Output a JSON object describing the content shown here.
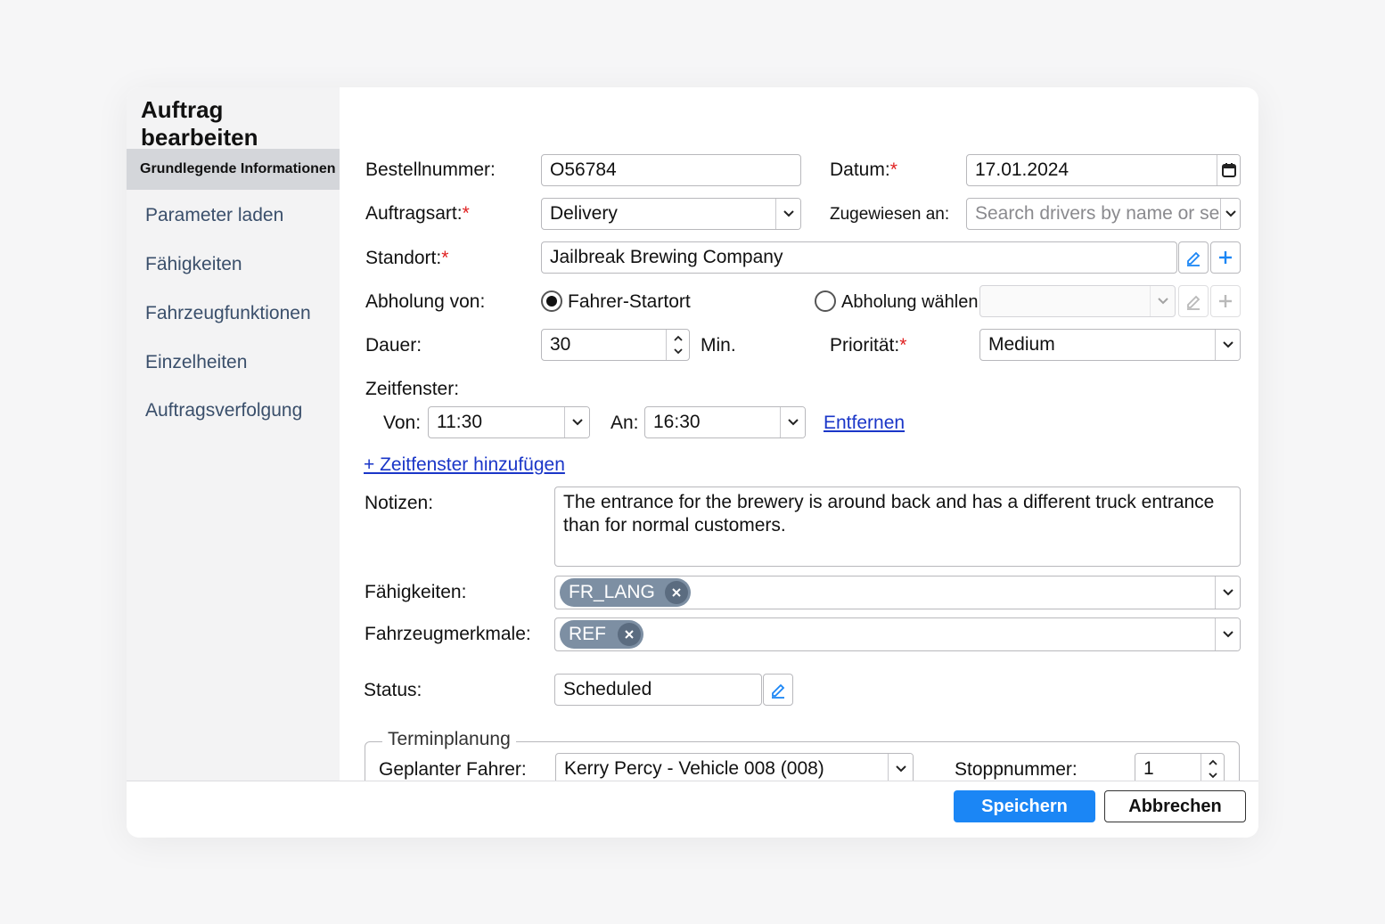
{
  "dialog": {
    "title": "Auftrag bearbeiten",
    "nav": [
      {
        "label": "Grundlegende Informationen"
      },
      {
        "label": "Parameter laden"
      },
      {
        "label": "Fähigkeiten"
      },
      {
        "label": "Fahrzeugfunktionen"
      },
      {
        "label": "Einzelheiten"
      },
      {
        "label": "Auftragsverfolgung"
      }
    ]
  },
  "form": {
    "order_number": {
      "label": "Bestellnummer:",
      "value": "O56784"
    },
    "date": {
      "label": "Datum:",
      "value": "17.01.2024"
    },
    "order_type": {
      "label": "Auftragsart:",
      "value": "Delivery"
    },
    "assigned_to": {
      "label": "Zugewiesen an:",
      "placeholder": "Search drivers by name or se"
    },
    "location": {
      "label": "Standort:",
      "value": "Jailbreak Brewing Company"
    },
    "pickup": {
      "label": "Abholung von:",
      "option_driver_start": "Fahrer-Startort",
      "option_choose": "Abholung wählen:",
      "selected": "driver_start"
    },
    "duration": {
      "label": "Dauer:",
      "value": "30",
      "unit": "Min."
    },
    "priority": {
      "label": "Priorität:",
      "value": "Medium"
    },
    "timewindow": {
      "label": "Zeitfenster:",
      "from_label": "Von:",
      "from_value": "11:30",
      "to_label": "An:",
      "to_value": "16:30",
      "remove_link": "Entfernen",
      "add_link": "+ Zeitfenster hinzufügen"
    },
    "notes": {
      "label": "Notizen:",
      "value": "The entrance for the brewery is around back and has a different truck entrance than for normal customers."
    },
    "skills": {
      "label": "Fähigkeiten:",
      "chips": [
        "FR_LANG"
      ]
    },
    "vehicle_features": {
      "label": "Fahrzeugmerkmale:",
      "chips": [
        "REF"
      ]
    },
    "status": {
      "label": "Status:",
      "value": "Scheduled"
    },
    "scheduling": {
      "legend": "Terminplanung",
      "driver_label": "Geplanter Fahrer:",
      "driver_value": "Kerry Percy - Vehicle 008 (008)",
      "stop_label": "Stoppnummer:",
      "stop_value": "1"
    }
  },
  "footer": {
    "save": "Speichern",
    "cancel": "Abbrechen"
  },
  "colors": {
    "primary": "#1b86f5",
    "required": "#e02020",
    "link": "#1a36c8",
    "chip": "#7d8fa3"
  }
}
